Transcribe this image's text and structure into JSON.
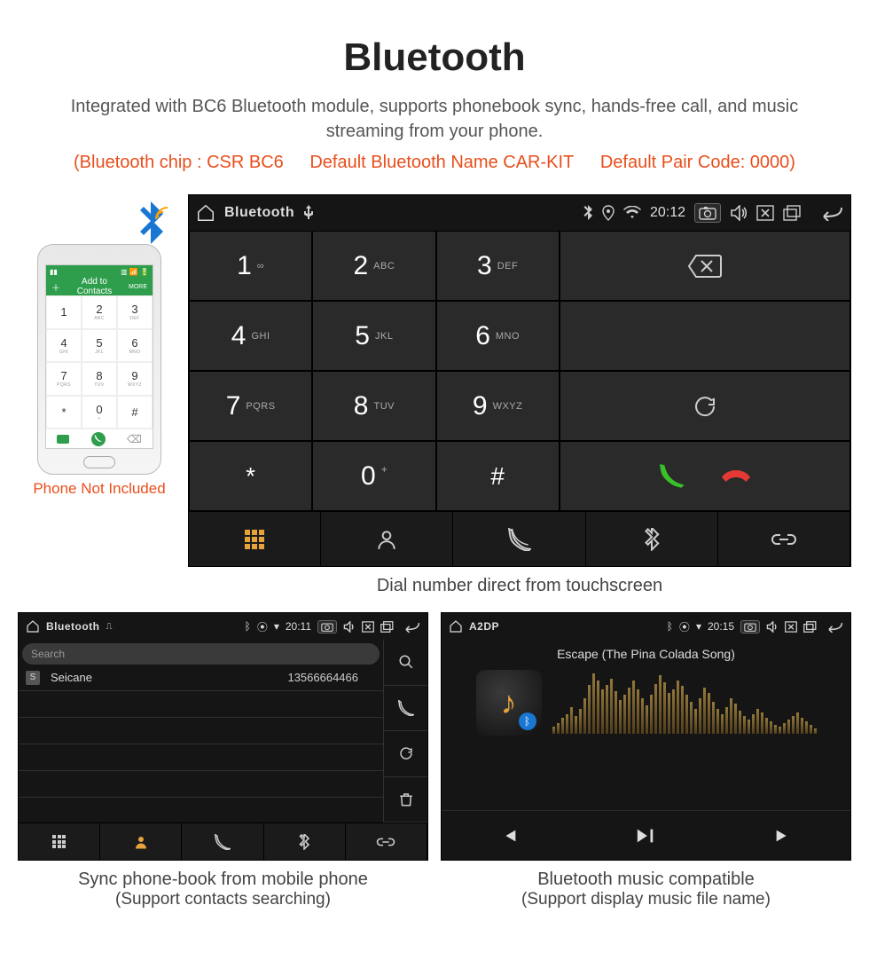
{
  "title": "Bluetooth",
  "subtitle": "Integrated with BC6 Bluetooth module, supports phonebook sync, hands-free call, and music streaming from your phone.",
  "specs": {
    "chip": "(Bluetooth chip : CSR BC6",
    "name": "Default Bluetooth Name CAR-KIT",
    "pair": "Default Pair Code: 0000)"
  },
  "phone": {
    "header_text": "Add to Contacts",
    "header_more": "MORE",
    "caption": "Phone Not Included",
    "keys": [
      {
        "n": "1",
        "l": ""
      },
      {
        "n": "2",
        "l": "ABC"
      },
      {
        "n": "3",
        "l": "DEF"
      },
      {
        "n": "4",
        "l": "GHI"
      },
      {
        "n": "5",
        "l": "JKL"
      },
      {
        "n": "6",
        "l": "MNO"
      },
      {
        "n": "7",
        "l": "PQRS"
      },
      {
        "n": "8",
        "l": "TUV"
      },
      {
        "n": "9",
        "l": "WXYZ"
      },
      {
        "n": "*",
        "l": ""
      },
      {
        "n": "0",
        "l": "+"
      },
      {
        "n": "#",
        "l": ""
      }
    ]
  },
  "dialer": {
    "status_label": "Bluetooth",
    "time": "20:12",
    "caption": "Dial number direct from touchscreen",
    "keys": [
      {
        "n": "1",
        "l": "∞"
      },
      {
        "n": "2",
        "l": "ABC"
      },
      {
        "n": "3",
        "l": "DEF"
      },
      {
        "n": "4",
        "l": "GHI"
      },
      {
        "n": "5",
        "l": "JKL"
      },
      {
        "n": "6",
        "l": "MNO"
      },
      {
        "n": "7",
        "l": "PQRS"
      },
      {
        "n": "8",
        "l": "TUV"
      },
      {
        "n": "9",
        "l": "WXYZ"
      },
      {
        "n": "*",
        "l": ""
      },
      {
        "n": "0",
        "l": "+"
      },
      {
        "n": "#",
        "l": ""
      }
    ]
  },
  "contacts": {
    "status_label": "Bluetooth",
    "time": "20:11",
    "search_placeholder": "Search",
    "contact_badge": "S",
    "contact_name": "Seicane",
    "contact_number": "13566664466",
    "caption_line1": "Sync phone-book from mobile phone",
    "caption_line2": "(Support contacts searching)"
  },
  "music": {
    "status_label": "A2DP",
    "time": "20:15",
    "song": "Escape (The Pina Colada Song)",
    "caption_line1": "Bluetooth music compatible",
    "caption_line2": "(Support display music file name)"
  }
}
